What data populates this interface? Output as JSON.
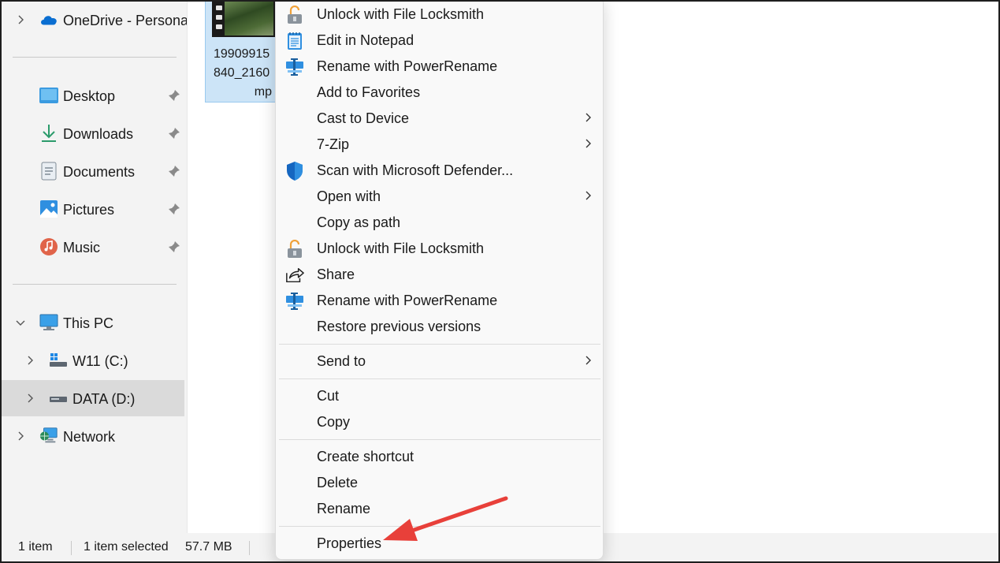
{
  "sidebar": {
    "onedrive": {
      "label": "OneDrive - Persona",
      "icon": "cloud-icon"
    },
    "quick_access": [
      {
        "label": "Desktop",
        "icon": "desktop-icon"
      },
      {
        "label": "Downloads",
        "icon": "download-icon"
      },
      {
        "label": "Documents",
        "icon": "document-icon"
      },
      {
        "label": "Pictures",
        "icon": "pictures-icon"
      },
      {
        "label": "Music",
        "icon": "music-icon"
      }
    ],
    "this_pc": {
      "label": "This PC",
      "icon": "monitor-icon"
    },
    "drives": [
      {
        "label": "W11 (C:)",
        "icon": "system-drive-icon"
      },
      {
        "label": "DATA (D:)",
        "icon": "drive-icon"
      }
    ],
    "network": {
      "label": "Network",
      "icon": "network-icon"
    }
  },
  "file": {
    "name_lines": [
      "19909915",
      "840_2160",
      "mp"
    ]
  },
  "context_menu": {
    "items": [
      {
        "label": "Unlock with File Locksmith",
        "icon": "unlock-icon"
      },
      {
        "label": "Edit in Notepad",
        "icon": "notepad-icon"
      },
      {
        "label": "Rename with PowerRename",
        "icon": "powerrename-icon"
      },
      {
        "label": "Add to Favorites"
      },
      {
        "label": "Cast to Device",
        "submenu": true
      },
      {
        "label": "7-Zip",
        "submenu": true
      },
      {
        "label": "Scan with Microsoft Defender...",
        "icon": "defender-shield-icon"
      },
      {
        "label": "Open with",
        "submenu": true
      },
      {
        "label": "Copy as path"
      },
      {
        "label": "Unlock with File Locksmith",
        "icon": "unlock-icon"
      },
      {
        "label": "Share",
        "icon": "share-icon"
      },
      {
        "label": "Rename with PowerRename",
        "icon": "powerrename-icon"
      },
      {
        "label": "Restore previous versions"
      },
      {
        "label": "Send to",
        "submenu": true
      },
      {
        "label": "Cut"
      },
      {
        "label": "Copy"
      },
      {
        "label": "Create shortcut"
      },
      {
        "label": "Delete"
      },
      {
        "label": "Rename"
      },
      {
        "label": "Properties"
      }
    ]
  },
  "status_bar": {
    "item_count": "1 item",
    "selection": "1 item selected",
    "size": "57.7 MB"
  },
  "colors": {
    "accent": "#0078d4",
    "arrow": "#e8403a",
    "selected_tile": "#cce4f7"
  }
}
